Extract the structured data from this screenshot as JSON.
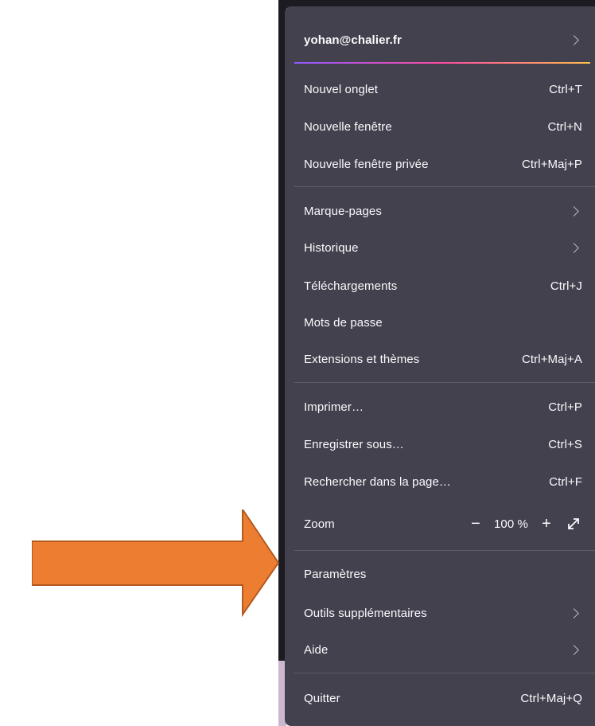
{
  "account": {
    "email": "yohan@chalier.fr"
  },
  "menu": {
    "new_tab": {
      "label": "Nouvel onglet",
      "shortcut": "Ctrl+T"
    },
    "new_window": {
      "label": "Nouvelle fenêtre",
      "shortcut": "Ctrl+N"
    },
    "new_private_window": {
      "label": "Nouvelle fenêtre privée",
      "shortcut": "Ctrl+Maj+P"
    },
    "bookmarks": {
      "label": "Marque-pages"
    },
    "history": {
      "label": "Historique"
    },
    "downloads": {
      "label": "Téléchargements",
      "shortcut": "Ctrl+J"
    },
    "passwords": {
      "label": "Mots de passe"
    },
    "addons": {
      "label": "Extensions et thèmes",
      "shortcut": "Ctrl+Maj+A"
    },
    "print": {
      "label": "Imprimer…",
      "shortcut": "Ctrl+P"
    },
    "save_as": {
      "label": "Enregistrer sous…",
      "shortcut": "Ctrl+S"
    },
    "find": {
      "label": "Rechercher dans la page…",
      "shortcut": "Ctrl+F"
    },
    "zoom": {
      "label": "Zoom",
      "minus": "−",
      "value": "100 %",
      "plus": "+"
    },
    "settings": {
      "label": "Paramètres"
    },
    "more_tools": {
      "label": "Outils supplémentaires"
    },
    "help": {
      "label": "Aide"
    },
    "quit": {
      "label": "Quitter",
      "shortcut": "Ctrl+Maj+Q"
    }
  },
  "colors": {
    "menu_bg": "#42414d",
    "arrow": "#ed7d31",
    "text": "#fbfbfe"
  },
  "icons": {
    "submenu": "chevron-right-icon",
    "fullscreen": "expand-arrows-icon",
    "annotation": "arrow-right-shape"
  }
}
